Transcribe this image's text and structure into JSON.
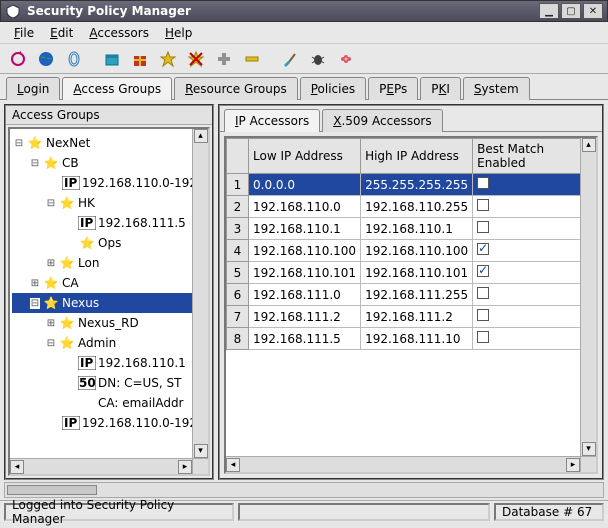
{
  "window": {
    "title": "Security Policy Manager"
  },
  "menu": {
    "file": "File",
    "edit": "Edit",
    "accessors": "Accessors",
    "help": "Help"
  },
  "maintabs": {
    "login": "Login",
    "access_groups": "Access Groups",
    "resource_groups": "Resource Groups",
    "policies": "Policies",
    "peps": "PEPs",
    "pki": "PKI",
    "system": "System"
  },
  "left_panel": {
    "title": "Access Groups"
  },
  "tree": {
    "root": "NexNet",
    "cb": "CB",
    "cb_ip": "192.168.110.0-192",
    "hk": "HK",
    "hk_ip": "192.168.111.5",
    "ops": "Ops",
    "lon": "Lon",
    "ca": "CA",
    "nexus": "Nexus",
    "nexus_rd": "Nexus_RD",
    "admin": "Admin",
    "admin_ip": "192.168.110.1",
    "dn": "DN: C=US, ST",
    "ca_email": "CA: emailAddr",
    "bottom_ip": "192.168.110.0-192"
  },
  "right_tabs": {
    "ip": "IP Accessors",
    "x509": "X.509 Accessors"
  },
  "table": {
    "headers": {
      "low": "Low IP Address",
      "high": "High IP Address",
      "best": "Best Match Enabled"
    },
    "rows": [
      {
        "n": "1",
        "low": "0.0.0.0",
        "high": "255.255.255.255",
        "best": false,
        "selected": true
      },
      {
        "n": "2",
        "low": "192.168.110.0",
        "high": "192.168.110.255",
        "best": false
      },
      {
        "n": "3",
        "low": "192.168.110.1",
        "high": "192.168.110.1",
        "best": false
      },
      {
        "n": "4",
        "low": "192.168.110.100",
        "high": "192.168.110.100",
        "best": true
      },
      {
        "n": "5",
        "low": "192.168.110.101",
        "high": "192.168.110.101",
        "best": true
      },
      {
        "n": "6",
        "low": "192.168.111.0",
        "high": "192.168.111.255",
        "best": false
      },
      {
        "n": "7",
        "low": "192.168.111.2",
        "high": "192.168.111.2",
        "best": false
      },
      {
        "n": "8",
        "low": "192.168.111.5",
        "high": "192.168.111.10",
        "best": false
      }
    ]
  },
  "status": {
    "left": "Logged into Security Policy Manager",
    "right": "Database # 67"
  }
}
